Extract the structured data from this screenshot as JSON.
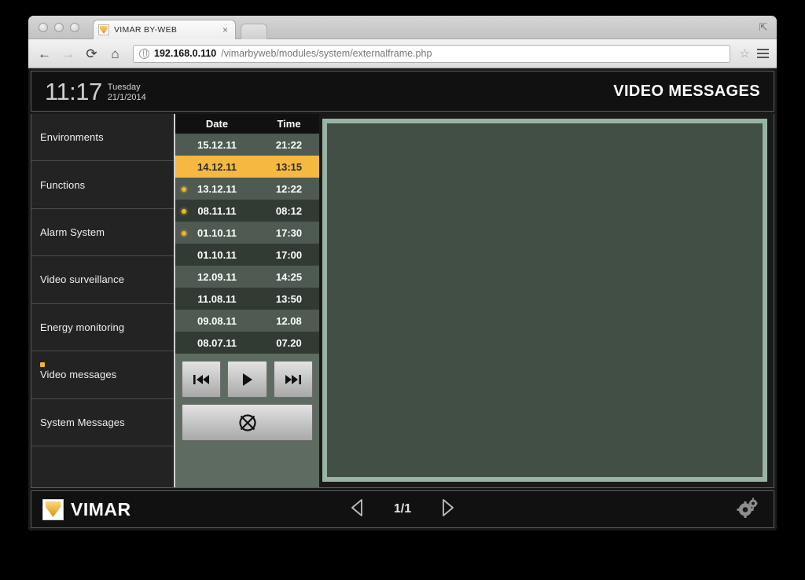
{
  "browser": {
    "tab": {
      "title": "VIMAR BY-WEB",
      "favicon": "vimar-favicon",
      "close_label": "×"
    },
    "new_tab_label": "",
    "restore_label": "⇱",
    "nav": {
      "back": "←",
      "forward": "→",
      "reload": "⟳",
      "home": "⌂"
    },
    "url": {
      "host": "192.168.0.110",
      "path": "/vimarbyweb/modules/system/externalframe.php"
    },
    "bookmark_label": "☆"
  },
  "header": {
    "time": "11:17",
    "day": "Tuesday",
    "date": "21/1/2014",
    "title": "VIDEO MESSAGES"
  },
  "sidebar": {
    "items": [
      {
        "label": "Environments",
        "dot": false
      },
      {
        "label": "Functions",
        "dot": false
      },
      {
        "label": "Alarm System",
        "dot": false
      },
      {
        "label": "Video surveillance",
        "dot": false
      },
      {
        "label": "Energy monitoring",
        "dot": false
      },
      {
        "label": "Video messages",
        "dot": true
      },
      {
        "label": "System Messages",
        "dot": false
      }
    ]
  },
  "message_list": {
    "columns": {
      "date": "Date",
      "time": "Time"
    },
    "rows": [
      {
        "date": "15.12.11",
        "time": "21:22",
        "unread": false,
        "selected": false
      },
      {
        "date": "14.12.11",
        "time": "13:15",
        "unread": false,
        "selected": true
      },
      {
        "date": "13.12.11",
        "time": "12:22",
        "unread": true,
        "selected": false
      },
      {
        "date": "08.11.11",
        "time": "08:12",
        "unread": true,
        "selected": false
      },
      {
        "date": "01.10.11",
        "time": "17:30",
        "unread": true,
        "selected": false
      },
      {
        "date": "01.10.11",
        "time": "17:00",
        "unread": false,
        "selected": false
      },
      {
        "date": "12.09.11",
        "time": "14:25",
        "unread": false,
        "selected": false
      },
      {
        "date": "11.08.11",
        "time": "13:50",
        "unread": false,
        "selected": false
      },
      {
        "date": "09.08.11",
        "time": "12.08",
        "unread": false,
        "selected": false
      },
      {
        "date": "08.07.11",
        "time": "07.20",
        "unread": false,
        "selected": false
      }
    ]
  },
  "player": {
    "previous_icon": "skip-back-icon",
    "play_icon": "play-icon",
    "next_icon": "skip-forward-icon",
    "delete_icon": "delete-crossed-circle-icon"
  },
  "video": {
    "placeholder": ""
  },
  "footer": {
    "brand": "VIMAR",
    "page_indicator": "1/1",
    "prev_icon": "triangle-left-icon",
    "next_icon": "triangle-right-icon",
    "settings_icon": "gears-icon"
  },
  "colors": {
    "accent_orange": "#f5b942",
    "unread_dot": "#f0b429",
    "video_border": "#9ab4a4",
    "video_fill": "#414f44",
    "panel_green": "#5d6b60",
    "row_odd": "#4e5a52",
    "row_even": "#323a34"
  }
}
